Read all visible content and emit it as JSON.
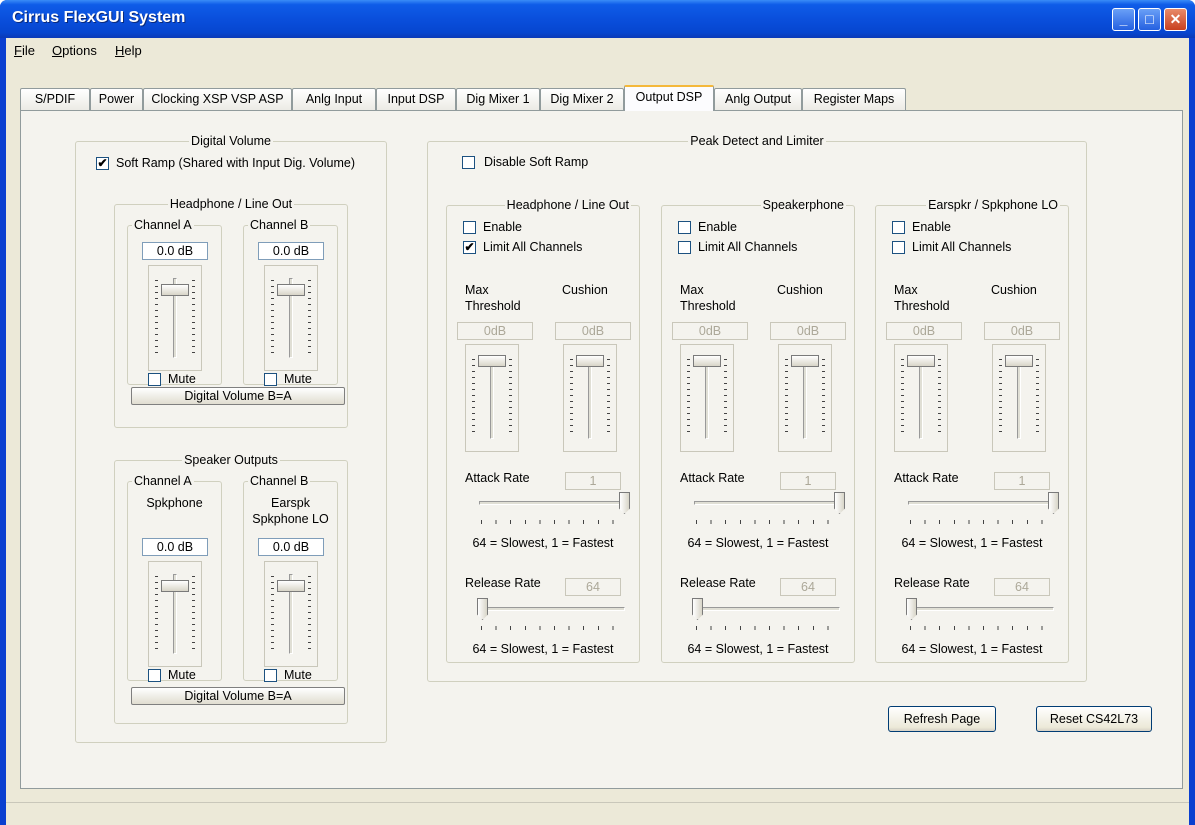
{
  "window": {
    "title": "Cirrus FlexGUI System",
    "minimize_icon": "minimize-icon",
    "maximize_icon": "maximize-icon",
    "close_icon": "close-icon"
  },
  "menu": [
    {
      "label": "File",
      "accel": "F",
      "rest": "ile"
    },
    {
      "label": "Options",
      "accel": "O",
      "rest": "ptions"
    },
    {
      "label": "Help",
      "accel": "H",
      "rest": "elp"
    }
  ],
  "tabs": [
    "S/PDIF",
    "Power",
    "Clocking XSP VSP ASP",
    "Anlg Input",
    "Input DSP",
    "Dig Mixer 1",
    "Dig Mixer 2",
    "Output DSP",
    "Anlg Output",
    "Register Maps"
  ],
  "active_tab": "Output DSP",
  "digital_volume": {
    "title": "Digital Volume",
    "soft_ramp_label": "Soft Ramp (Shared with Input Dig. Volume)",
    "soft_ramp_checked": true,
    "headphone": {
      "title": "Headphone / Line Out",
      "channel_a": {
        "title": "Channel A",
        "value": "0.0 dB",
        "mute": "Mute"
      },
      "channel_b": {
        "title": "Channel B",
        "value": "0.0 dB",
        "mute": "Mute"
      },
      "b_eq_a_button": "Digital Volume B=A"
    },
    "speaker": {
      "title": "Speaker Outputs",
      "channel_a": {
        "title": "Channel A",
        "sub": "Spkphone",
        "value": "0.0 dB",
        "mute": "Mute"
      },
      "channel_b": {
        "title": "Channel B",
        "sub1": "Earspk",
        "sub2": "Spkphone LO",
        "value": "0.0 dB",
        "mute": "Mute"
      },
      "b_eq_a_button": "Digital Volume B=A"
    }
  },
  "peak": {
    "title": "Peak Detect and Limiter",
    "disable_soft_ramp": "Disable Soft Ramp",
    "groups": [
      {
        "title": "Headphone / Line Out",
        "enable": "Enable",
        "limit_all": "Limit All Channels",
        "limit_checked": true,
        "max1": "Max",
        "max2": "Threshold",
        "cushion": "Cushion",
        "max_value": "0dB",
        "cushion_value": "0dB",
        "attack": "Attack Rate",
        "attack_value": "1",
        "attack_note": "64 = Slowest, 1 = Fastest",
        "release": "Release Rate",
        "release_value": "64",
        "release_note": "64 = Slowest, 1 = Fastest"
      },
      {
        "title": "Speakerphone",
        "enable": "Enable",
        "limit_all": "Limit All Channels",
        "limit_checked": false,
        "max1": "Max",
        "max2": "Threshold",
        "cushion": "Cushion",
        "max_value": "0dB",
        "cushion_value": "0dB",
        "attack": "Attack Rate",
        "attack_value": "1",
        "attack_note": "64 = Slowest, 1 = Fastest",
        "release": "Release Rate",
        "release_value": "64",
        "release_note": "64 = Slowest, 1 = Fastest"
      },
      {
        "title": "Earspkr / Spkphone LO",
        "enable": "Enable",
        "limit_all": "Limit All Channels",
        "limit_checked": false,
        "max1": "Max",
        "max2": "Threshold",
        "cushion": "Cushion",
        "max_value": "0dB",
        "cushion_value": "0dB",
        "attack": "Attack Rate",
        "attack_value": "1",
        "attack_note": "64 = Slowest, 1 = Fastest",
        "release": "Release Rate",
        "release_value": "64",
        "release_note": "64 = Slowest, 1 = Fastest"
      }
    ]
  },
  "buttons": {
    "refresh": "Refresh Page",
    "reset": "Reset CS42L73"
  }
}
